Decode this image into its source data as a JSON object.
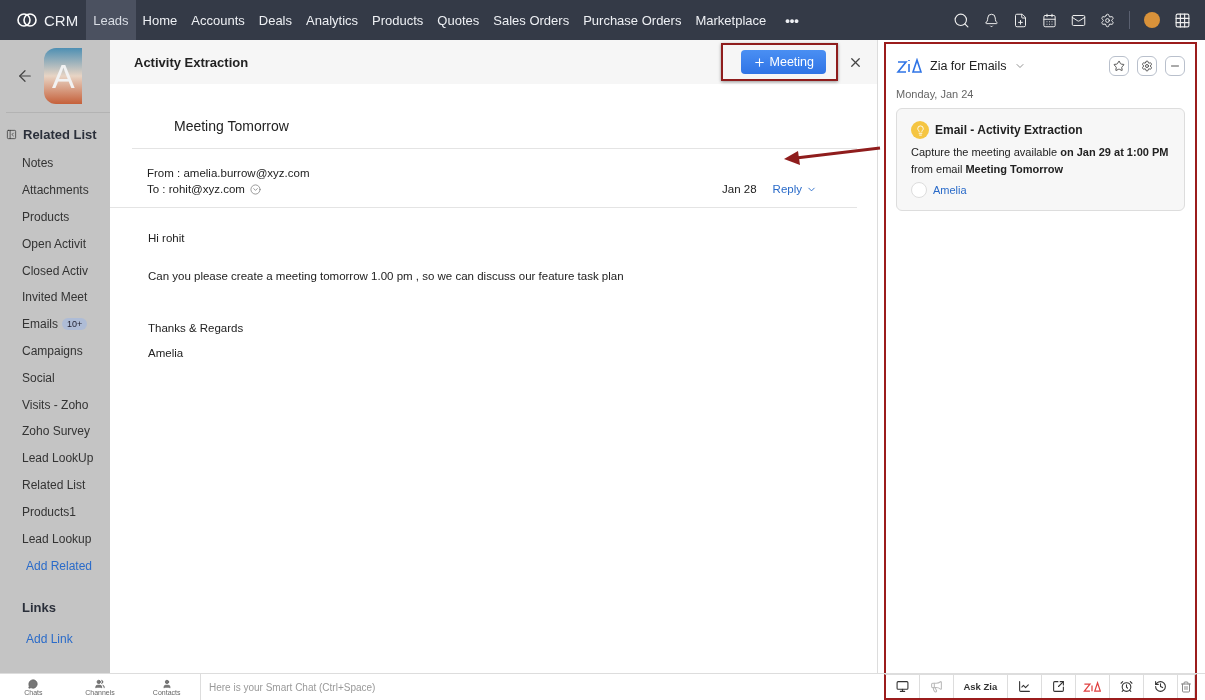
{
  "nav": {
    "brand": "CRM",
    "more": "•••",
    "tabs": [
      {
        "label": "Leads",
        "selected": true
      },
      {
        "label": "Home",
        "selected": false
      },
      {
        "label": "Accounts",
        "selected": false
      },
      {
        "label": "Deals",
        "selected": false
      },
      {
        "label": "Analytics",
        "selected": false
      },
      {
        "label": "Products",
        "selected": false
      },
      {
        "label": "Quotes",
        "selected": false
      },
      {
        "label": "Sales Orders",
        "selected": false
      },
      {
        "label": "Purchase Orders",
        "selected": false
      },
      {
        "label": "Marketplace",
        "selected": false
      }
    ]
  },
  "record": {
    "initial": "A"
  },
  "related_list": {
    "title": "Related List",
    "items": [
      {
        "label": "Notes"
      },
      {
        "label": "Attachments"
      },
      {
        "label": "Products"
      },
      {
        "label": "Open Activit"
      },
      {
        "label": "Closed Activ"
      },
      {
        "label": "Invited Meet"
      },
      {
        "label": "Emails",
        "badge": "10+"
      },
      {
        "label": "Campaigns"
      },
      {
        "label": "Social"
      },
      {
        "label": "Visits - Zoho"
      },
      {
        "label": "Zoho Survey"
      },
      {
        "label": "Lead LookUp"
      },
      {
        "label": "Related List"
      },
      {
        "label": "Products1"
      },
      {
        "label": "Lead Lookup"
      }
    ],
    "add": "Add Related"
  },
  "links": {
    "title": "Links",
    "add": "Add Link"
  },
  "activity_panel": {
    "title": "Activity Extraction",
    "action": "Meeting",
    "email": {
      "subject": "Meeting Tomorrow",
      "from": "From : amelia.burrow@xyz.com",
      "to": "To : rohit@xyz.com",
      "date": "Jan 28",
      "reply": "Reply",
      "greeting": "Hi rohit",
      "message": "Can you please create a meeting tomorrow 1.00 pm , so we can discuss our feature task plan",
      "signoff": "Thanks & Regards",
      "signature": "Amelia"
    }
  },
  "zia": {
    "title": "Zia for Emails",
    "date": "Monday, Jan 24",
    "card": {
      "title": "Email - Activity Extraction",
      "text": "Capture the meeting available **on Jan 29 at 1:00 PM** from email **Meeting Tomorrow**",
      "contact": "Amelia"
    },
    "ask_label": "Ask Zia"
  },
  "chat_bar": {
    "tabs": [
      {
        "label": "Chats"
      },
      {
        "label": "Channels"
      },
      {
        "label": "Contacts"
      }
    ],
    "placeholder": "Here is your Smart Chat (Ctrl+Space)"
  }
}
